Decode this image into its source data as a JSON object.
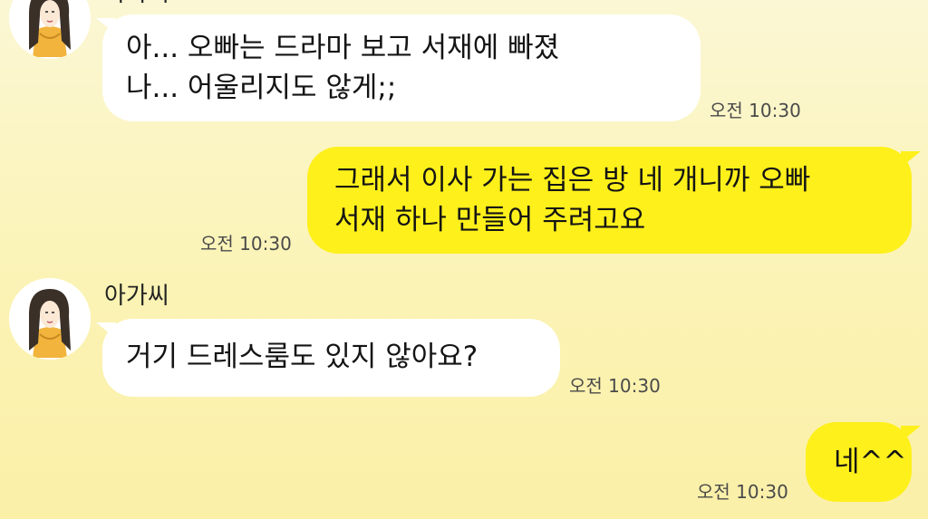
{
  "accent_colors": {
    "incoming_bubble": "#ffffff",
    "outgoing_bubble": "#fef01b",
    "background": "#fbf3b5"
  },
  "messages": [
    {
      "direction": "incoming",
      "sender": "아가씨",
      "text": "아... 오빠는 드라마 보고 서재에 빠졌\n나... 어울리지도 않게;;",
      "time": "오전 10:30"
    },
    {
      "direction": "outgoing",
      "text": "그래서 이사 가는 집은 방 네 개니까 오빠\n서재 하나 만들어 주려고요",
      "time": "오전 10:30"
    },
    {
      "direction": "incoming",
      "sender": "아가씨",
      "text": "거기 드레스룸도 있지 않아요?",
      "time": "오전 10:30"
    },
    {
      "direction": "outgoing",
      "text": "네^^",
      "time": "오전 10:30"
    }
  ]
}
